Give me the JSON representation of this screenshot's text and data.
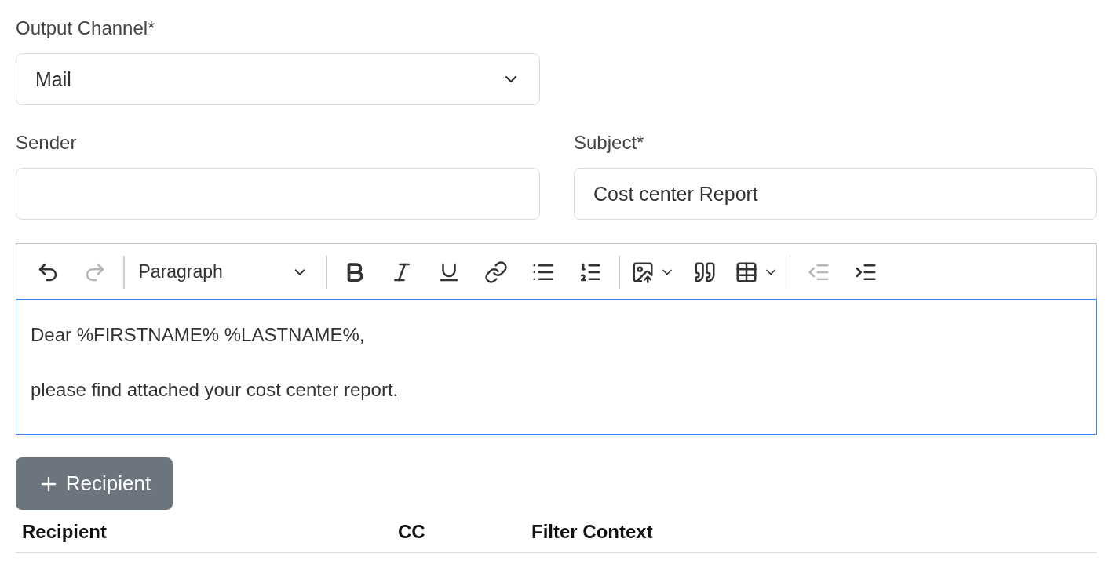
{
  "output_channel": {
    "label": "Output Channel*",
    "value": "Mail"
  },
  "sender": {
    "label": "Sender"
  },
  "subject": {
    "label": "Subject*",
    "value": "Cost center Report"
  },
  "editor": {
    "focused": true,
    "toolbar": [
      {
        "kind": "undo",
        "disabled": false
      },
      {
        "kind": "redo",
        "disabled": true
      },
      {
        "kind": "separator"
      },
      {
        "kind": "heading",
        "label": "Paragraph"
      },
      {
        "kind": "separator"
      },
      {
        "kind": "bold",
        "disabled": false
      },
      {
        "kind": "italic",
        "disabled": false
      },
      {
        "kind": "underline",
        "disabled": false
      },
      {
        "kind": "link",
        "disabled": false
      },
      {
        "kind": "bulleted-list",
        "disabled": false
      },
      {
        "kind": "numbered-list",
        "disabled": false
      },
      {
        "kind": "separator"
      },
      {
        "kind": "image",
        "disabled": false
      },
      {
        "kind": "quote",
        "disabled": false
      },
      {
        "kind": "table",
        "disabled": false
      },
      {
        "kind": "separator"
      },
      {
        "kind": "outdent",
        "disabled": true
      },
      {
        "kind": "indent",
        "disabled": false
      }
    ],
    "paragraphs": [
      "Dear %FIRSTNAME% %LASTNAME%,",
      "please find attached your cost center report."
    ]
  },
  "add_recipient_button": {
    "label": "Recipient"
  },
  "table": {
    "columns": [
      "Recipient",
      "CC",
      "Filter Context"
    ]
  }
}
